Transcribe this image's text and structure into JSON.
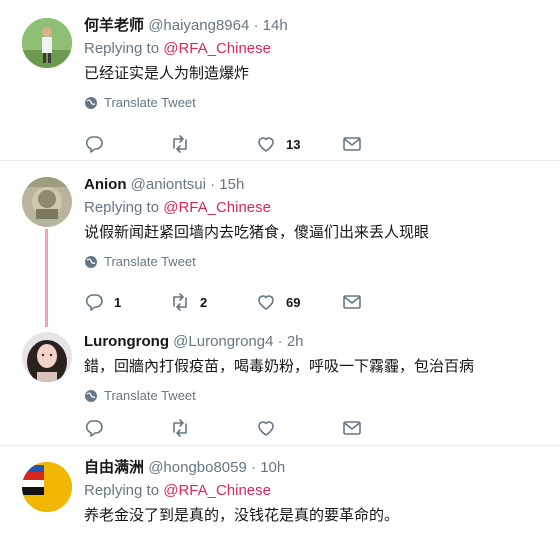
{
  "tweets": [
    {
      "name": "何羊老师",
      "handle": "@haiyang8964",
      "time": "14h",
      "reply_prefix": "Replying to",
      "reply_to": "@RFA_Chinese",
      "text": "已经证实是人为制造爆炸",
      "translate": "Translate Tweet",
      "replies": "",
      "retweets": "",
      "likes": "13"
    },
    {
      "name": "Anion",
      "handle": "@aniontsui",
      "time": "15h",
      "reply_prefix": "Replying to",
      "reply_to": "@RFA_Chinese",
      "text": "说假新闻赶紧回墙内去吃猪食，傻逼们出来丢人现眼",
      "translate": "Translate Tweet",
      "replies": "1",
      "retweets": "2",
      "likes": "69"
    },
    {
      "name": "Lurongrong",
      "handle": "@Lurongrong4",
      "time": "2h",
      "text": "錯，回牆內打假疫苗，喝毒奶粉，呼吸一下霧霾，包治百病",
      "translate": "Translate Tweet",
      "replies": "",
      "retweets": "",
      "likes": ""
    },
    {
      "name": "自由满洲",
      "handle": "@hongbo8059",
      "time": "10h",
      "reply_prefix": "Replying to",
      "reply_to": "@RFA_Chinese",
      "text": "养老金没了到是真的，没钱花是真的要革命的。"
    }
  ],
  "separator": "·",
  "colors": {
    "mention": "#e0245e",
    "muted": "#657786",
    "thread": "#f4a3ad",
    "border": "#e6ecf0"
  },
  "icons": [
    "globe-icon",
    "reply-icon",
    "retweet-icon",
    "like-icon",
    "message-icon"
  ]
}
